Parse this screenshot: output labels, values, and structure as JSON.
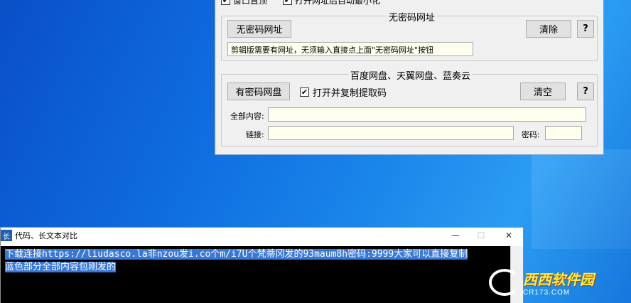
{
  "top_options": {
    "window_on_top": "窗口置顶",
    "auto_minimize": "打开网址后自动最小化"
  },
  "group_no_password": {
    "title": "无密码网址",
    "open_button": "无密码网址",
    "clear_button": "清除",
    "help_button": "?",
    "hint_text": "剪辑版需要有网址，无须输入直接点上面\"无密码网址\"按钮"
  },
  "group_password": {
    "title": "百度网盘、天翼网盘、蓝奏云",
    "open_button": "有密码网盘",
    "copy_checkbox_label": "打开并复制提取码",
    "copy_checkbox_checked": true,
    "clear_button": "清空",
    "help_button": "?",
    "all_content_label": "全部内容:",
    "all_content_value": "",
    "link_label": "链接:",
    "link_value": "",
    "code_label": "密码:",
    "code_value": ""
  },
  "compare_window": {
    "icon_char": "长",
    "title": "代码、长文本对比",
    "minimize": "—",
    "maximize": "☐",
    "close": "✕",
    "line1": "下载连接https://liudasco.la非nzou发i.co个m/i7U个梵蒂冈发的93maum8h密码:9999大家可以直接复制",
    "line2": "蓝色部分全部内容包刚发的"
  },
  "watermark": {
    "main": "西西软件园",
    "sub": "CR173.COM"
  },
  "colors": {
    "selection": "#3a78d8",
    "field_bg": "#fffff0",
    "window_bg": "#f0f0f0"
  }
}
